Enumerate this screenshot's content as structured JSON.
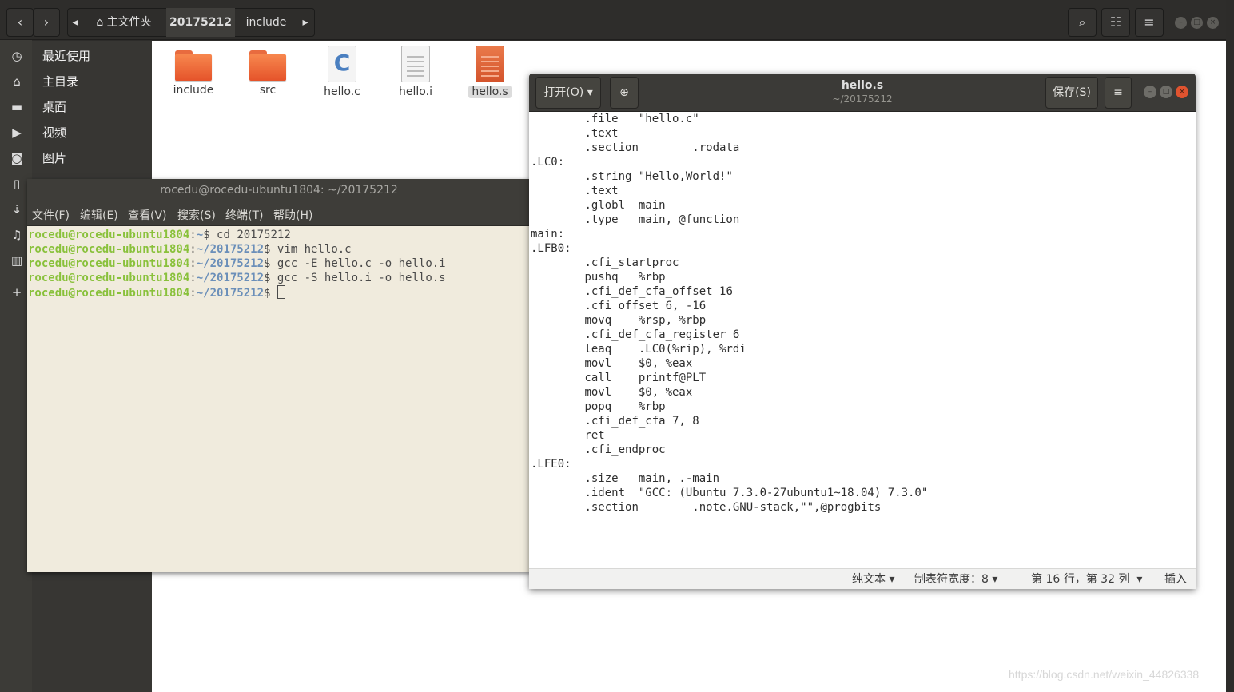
{
  "file_manager": {
    "breadcrumbs": [
      "主文件夹",
      "20175212",
      "include"
    ],
    "sidebar": [
      "最近使用",
      "主目录",
      "桌面",
      "视频",
      "图片"
    ],
    "files": [
      {
        "name": "include",
        "kind": "folder"
      },
      {
        "name": "src",
        "kind": "folder"
      },
      {
        "name": "hello.c",
        "kind": "c-source"
      },
      {
        "name": "hello.i",
        "kind": "text"
      },
      {
        "name": "hello.s",
        "kind": "assembly",
        "selected": true
      }
    ]
  },
  "terminal": {
    "title": "rocedu@rocedu-ubuntu1804: ~/20175212",
    "menu": [
      "文件(F)",
      "编辑(E)",
      "查看(V)",
      "搜索(S)",
      "终端(T)",
      "帮助(H)"
    ],
    "lines": [
      {
        "user": "rocedu@rocedu-ubuntu1804",
        "path": "~",
        "cmd": "cd 20175212"
      },
      {
        "user": "rocedu@rocedu-ubuntu1804",
        "path": "~/20175212",
        "cmd": "vim hello.c"
      },
      {
        "user": "rocedu@rocedu-ubuntu1804",
        "path": "~/20175212",
        "cmd": "gcc -E hello.c -o hello.i"
      },
      {
        "user": "rocedu@rocedu-ubuntu1804",
        "path": "~/20175212",
        "cmd": "gcc -S hello.i -o hello.s"
      },
      {
        "user": "rocedu@rocedu-ubuntu1804",
        "path": "~/20175212",
        "cmd": ""
      }
    ]
  },
  "editor": {
    "open_label": "打开(O)",
    "save_label": "保存(S)",
    "title": "hello.s",
    "subtitle": "~/20175212",
    "code": "\t.file\t\"hello.c\"\n\t.text\n\t.section\t.rodata\n.LC0:\n\t.string \"Hello,World!\"\n\t.text\n\t.globl\tmain\n\t.type\tmain, @function\nmain:\n.LFB0:\n\t.cfi_startproc\n\tpushq\t%rbp\n\t.cfi_def_cfa_offset 16\n\t.cfi_offset 6, -16\n\tmovq\t%rsp, %rbp\n\t.cfi_def_cfa_register 6\n\tleaq\t.LC0(%rip), %rdi\n\tmovl\t$0, %eax\n\tcall\tprintf@PLT\n\tmovl\t$0, %eax\n\tpopq\t%rbp\n\t.cfi_def_cfa 7, 8\n\tret\n\t.cfi_endproc\n.LFE0:\n\t.size\tmain, .-main\n\t.ident\t\"GCC: (Ubuntu 7.3.0-27ubuntu1~18.04) 7.3.0\"\n\t.section\t.note.GNU-stack,\"\",@progbits",
    "status": {
      "language": "纯文本",
      "tab_width": "制表符宽度：8",
      "position": "第 16 行，第 32 列",
      "mode": "插入"
    }
  },
  "watermark": "https://blog.csdn.net/weixin_44826338"
}
